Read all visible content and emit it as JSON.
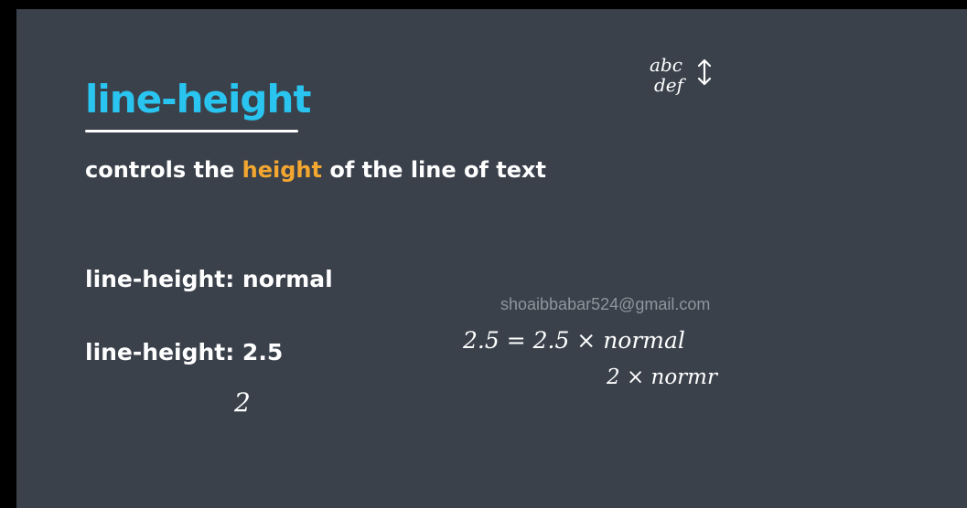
{
  "slide": {
    "title": "line-height",
    "subtitle_before": "controls the ",
    "subtitle_highlight": "height",
    "subtitle_after": " of the line of text",
    "lines": [
      "line-height: normal",
      "line-height: 2.5"
    ],
    "watermark": "shoaibbabar524@gmail.com"
  },
  "handwriting": {
    "top_right_line1": "abc",
    "top_right_line2": "def",
    "equation": "2.5 = 2.5 × normal",
    "below_equation": "2 × normr",
    "below_line2": "2"
  },
  "colors": {
    "background": "#3a414b",
    "title": "#29c4ef",
    "highlight": "#f3a630",
    "text": "#ffffff"
  }
}
